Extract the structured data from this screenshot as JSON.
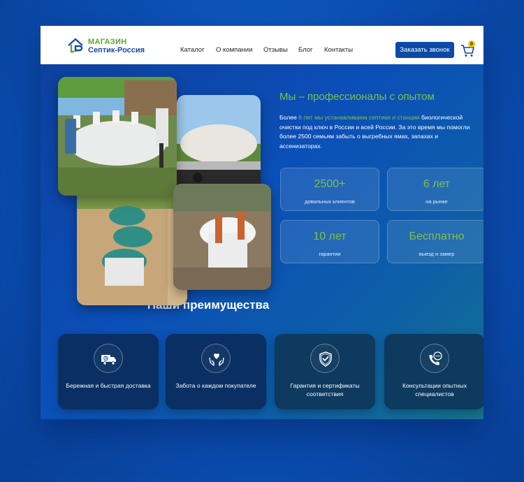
{
  "logo": {
    "line1": "МАГАЗИН",
    "line2": "Септик-Россия"
  },
  "nav": {
    "items": [
      {
        "label": "Каталог"
      },
      {
        "label": "О компании"
      },
      {
        "label": "Отзывы"
      },
      {
        "label": "Блог"
      },
      {
        "label": "Контакты"
      }
    ]
  },
  "header": {
    "call_button": "Заказать звонок",
    "cart_count": "0"
  },
  "hero": {
    "title": "Мы – профессионалы с опытом",
    "text_prefix": "Более ",
    "text_highlight": "6 лет мы устанавливаем  септики и станции",
    "text_suffix": " биологической очистки под ключ в России и всей России. За это время мы помогли более 2500 семьям забыть о выгребных ямах, запахах и ассенизаторах."
  },
  "stats": [
    {
      "value": "2500+",
      "label": "довольных клиентов"
    },
    {
      "value": "6 лет",
      "label": "на рынке"
    },
    {
      "value": "10 лет",
      "label": "гарантии"
    },
    {
      "value": "Бесплатно",
      "label": "выезд и замер"
    }
  ],
  "advantages": {
    "title": "Наши преимущества",
    "items": [
      {
        "label": "Бережная и быстрая доставка",
        "icon": "delivery-truck-icon"
      },
      {
        "label": "Забота о каждом покупателе",
        "icon": "heart-hands-icon"
      },
      {
        "label": "Гарантия и сертификаты соответствия",
        "icon": "shield-check-icon"
      },
      {
        "label": "Консультации опытных специалистов",
        "icon": "phone-chat-icon"
      }
    ]
  },
  "colors": {
    "accent_green": "#7cc24a",
    "brand_blue": "#0d4aa8"
  }
}
